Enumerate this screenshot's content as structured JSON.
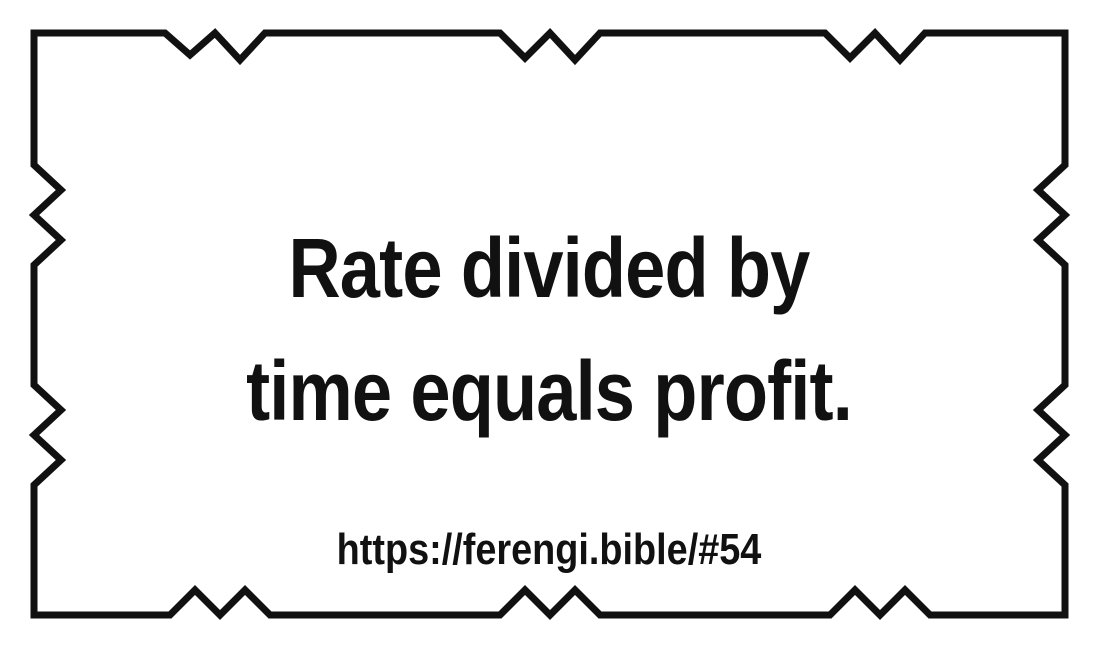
{
  "quote": {
    "line1": "Rate divided by",
    "line2": "time equals profit."
  },
  "source": {
    "url": "https://ferengi.bible/#54"
  },
  "colors": {
    "ink": "#111111",
    "background": "#ffffff"
  }
}
